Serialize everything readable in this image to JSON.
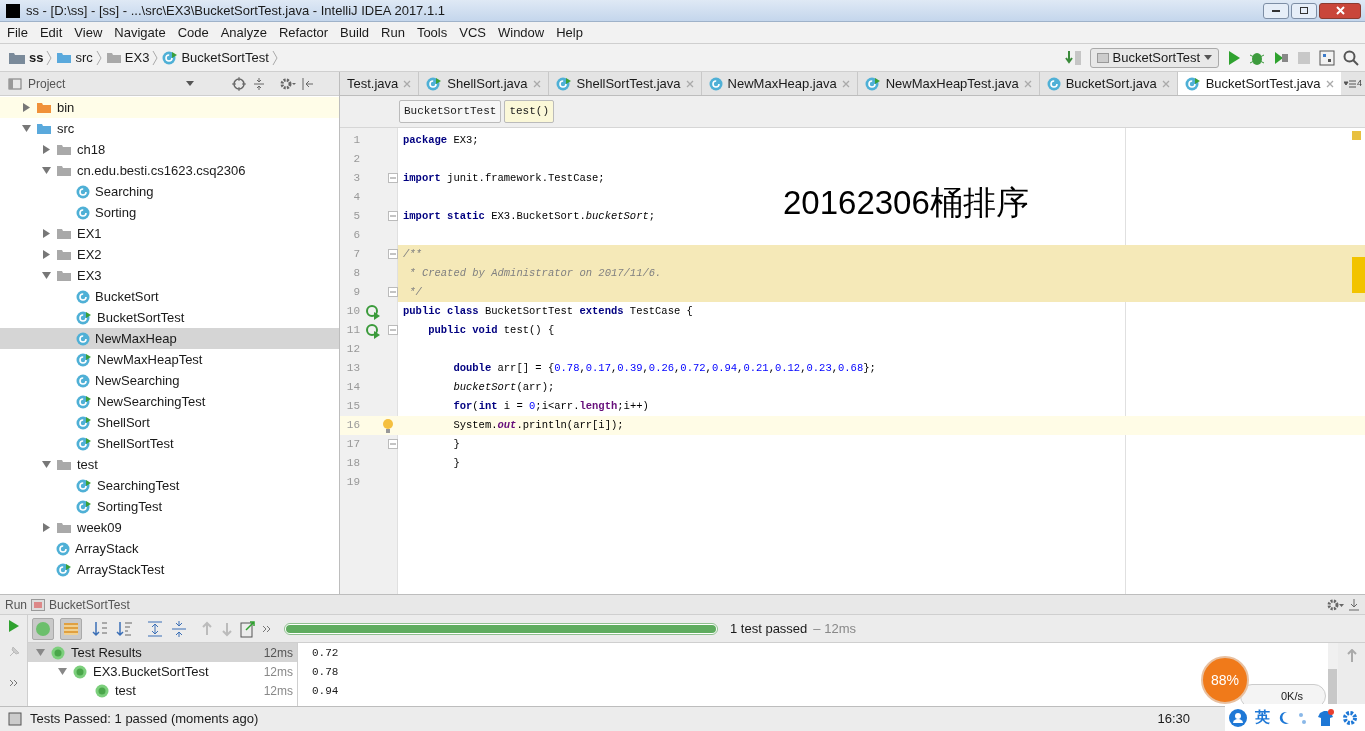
{
  "window": {
    "title": "ss - [D:\\ss] - [ss] - ...\\src\\EX3\\BucketSortTest.java - IntelliJ IDEA 2017.1.1"
  },
  "menu": [
    "File",
    "Edit",
    "View",
    "Navigate",
    "Code",
    "Analyze",
    "Refactor",
    "Build",
    "Run",
    "Tools",
    "VCS",
    "Window",
    "Help"
  ],
  "breadcrumbs": [
    {
      "label": "ss",
      "kind": "project"
    },
    {
      "label": "src",
      "kind": "source"
    },
    {
      "label": "EX3",
      "kind": "package"
    },
    {
      "label": "BucketSortTest",
      "kind": "test"
    }
  ],
  "run_config": "BucketSortTest",
  "project_panel": {
    "title": "Project",
    "tree": [
      {
        "label": "bin",
        "kind": "excluded",
        "expanded": false,
        "selected": false
      },
      {
        "label": "src",
        "kind": "source",
        "expanded": true,
        "selected": false,
        "children": [
          {
            "label": "ch18",
            "kind": "package",
            "expanded": false,
            "selected": false
          },
          {
            "label": "cn.edu.besti.cs1623.csq2306",
            "kind": "package",
            "expanded": true,
            "selected": false,
            "children": [
              {
                "label": "Searching",
                "kind": "class",
                "selected": false
              },
              {
                "label": "Sorting",
                "kind": "class",
                "selected": false
              }
            ]
          },
          {
            "label": "EX1",
            "kind": "package",
            "expanded": false,
            "selected": false
          },
          {
            "label": "EX2",
            "kind": "package",
            "expanded": false,
            "selected": false
          },
          {
            "label": "EX3",
            "kind": "package",
            "expanded": true,
            "selected": false,
            "children": [
              {
                "label": "BucketSort",
                "kind": "class",
                "selected": false
              },
              {
                "label": "BucketSortTest",
                "kind": "test",
                "selected": false
              },
              {
                "label": "NewMaxHeap",
                "kind": "class",
                "selected": true
              },
              {
                "label": "NewMaxHeapTest",
                "kind": "test",
                "selected": false
              },
              {
                "label": "NewSearching",
                "kind": "class",
                "selected": false
              },
              {
                "label": "NewSearchingTest",
                "kind": "test",
                "selected": false
              },
              {
                "label": "ShellSort",
                "kind": "test",
                "selected": false
              },
              {
                "label": "ShellSortTest",
                "kind": "test",
                "selected": false
              }
            ]
          },
          {
            "label": "test",
            "kind": "package",
            "expanded": true,
            "selected": false,
            "children": [
              {
                "label": "SearchingTest",
                "kind": "test",
                "selected": false
              },
              {
                "label": "SortingTest",
                "kind": "test",
                "selected": false
              }
            ]
          },
          {
            "label": "week09",
            "kind": "package",
            "expanded": false,
            "selected": false
          },
          {
            "label": "ArrayStack",
            "kind": "class",
            "selected": false
          },
          {
            "label": "ArrayStackTest",
            "kind": "test",
            "selected": false
          }
        ]
      }
    ]
  },
  "tabs": [
    {
      "label": "Test.java",
      "kind": "none",
      "selected": false
    },
    {
      "label": "ShellSort.java",
      "kind": "test",
      "selected": false
    },
    {
      "label": "ShellSortTest.java",
      "kind": "test",
      "selected": false
    },
    {
      "label": "NewMaxHeap.java",
      "kind": "class",
      "selected": false
    },
    {
      "label": "NewMaxHeapTest.java",
      "kind": "test",
      "selected": false
    },
    {
      "label": "BucketSort.java",
      "kind": "class",
      "selected": false
    },
    {
      "label": "BucketSortTest.java",
      "kind": "test",
      "selected": true
    }
  ],
  "tabs_overflow": "4",
  "editor_breadcrumbs": [
    {
      "label": "BucketSortTest",
      "selected": false
    },
    {
      "label": "test()",
      "selected": true
    }
  ],
  "overlay_text": "20162306桶排序",
  "code": [
    {
      "number": "1",
      "fold": false,
      "run_marker": false,
      "bulb": false,
      "doc_comment": false,
      "current_line": false,
      "tokens": [
        {
          "kind": "kw",
          "text": "package"
        },
        {
          "kind": "plain",
          "text": " EX3;"
        }
      ]
    },
    {
      "number": "2",
      "fold": false,
      "run_marker": false,
      "bulb": false,
      "doc_comment": false,
      "current_line": false
    },
    {
      "number": "3",
      "fold": true,
      "run_marker": false,
      "bulb": false,
      "doc_comment": false,
      "current_line": false,
      "tokens": [
        {
          "kind": "kw",
          "text": "import"
        },
        {
          "kind": "plain",
          "text": " junit.framework.TestCase;"
        }
      ]
    },
    {
      "number": "4",
      "fold": false,
      "run_marker": false,
      "bulb": false,
      "doc_comment": false,
      "current_line": false
    },
    {
      "number": "5",
      "fold": true,
      "run_marker": false,
      "bulb": false,
      "doc_comment": false,
      "current_line": false,
      "tokens": [
        {
          "kind": "kw",
          "text": "import static"
        },
        {
          "kind": "plain",
          "text": " EX3.BucketSort."
        },
        {
          "kind": "italic",
          "text": "bucketSort"
        },
        {
          "kind": "plain",
          "text": ";"
        }
      ]
    },
    {
      "number": "6",
      "fold": false,
      "run_marker": false,
      "bulb": false,
      "doc_comment": false,
      "current_line": false
    },
    {
      "number": "7",
      "fold": true,
      "run_marker": false,
      "bulb": false,
      "doc_comment": true,
      "current_line": false,
      "tokens": [
        {
          "kind": "comment",
          "text": "/**"
        }
      ]
    },
    {
      "number": "8",
      "fold": false,
      "run_marker": false,
      "bulb": false,
      "doc_comment": true,
      "current_line": false,
      "tokens": [
        {
          "kind": "comment",
          "text": " * Created by Administrator on 2017/11/6."
        }
      ]
    },
    {
      "number": "9",
      "fold": true,
      "run_marker": false,
      "bulb": false,
      "doc_comment": true,
      "current_line": false,
      "tokens": [
        {
          "kind": "comment",
          "text": " */"
        }
      ]
    },
    {
      "number": "10",
      "fold": false,
      "run_marker": true,
      "bulb": false,
      "doc_comment": false,
      "current_line": false,
      "tokens": [
        {
          "kind": "kw",
          "text": "public class"
        },
        {
          "kind": "plain",
          "text": " BucketSortTest "
        },
        {
          "kind": "kw",
          "text": "extends"
        },
        {
          "kind": "plain",
          "text": " TestCase {"
        }
      ]
    },
    {
      "number": "11",
      "fold": true,
      "run_marker": true,
      "bulb": false,
      "doc_comment": false,
      "current_line": false,
      "tokens": [
        {
          "kind": "kw",
          "text": "    public void"
        },
        {
          "kind": "plain",
          "text": " test() {"
        }
      ]
    },
    {
      "number": "12",
      "fold": false,
      "run_marker": false,
      "bulb": false,
      "doc_comment": false,
      "current_line": false
    },
    {
      "number": "13",
      "fold": false,
      "run_marker": false,
      "bulb": false,
      "doc_comment": false,
      "current_line": false,
      "tokens": [
        {
          "kind": "kw",
          "text": "        double"
        },
        {
          "kind": "plain",
          "text": " arr[] = {"
        },
        {
          "kind": "num",
          "text": "0.78"
        },
        {
          "kind": "plain",
          "text": ","
        },
        {
          "kind": "num",
          "text": "0.17"
        },
        {
          "kind": "plain",
          "text": ","
        },
        {
          "kind": "num",
          "text": "0.39"
        },
        {
          "kind": "plain",
          "text": ","
        },
        {
          "kind": "num",
          "text": "0.26"
        },
        {
          "kind": "plain",
          "text": ","
        },
        {
          "kind": "num",
          "text": "0.72"
        },
        {
          "kind": "plain",
          "text": ","
        },
        {
          "kind": "num",
          "text": "0.94"
        },
        {
          "kind": "plain",
          "text": ","
        },
        {
          "kind": "num",
          "text": "0.21"
        },
        {
          "kind": "plain",
          "text": ","
        },
        {
          "kind": "num",
          "text": "0.12"
        },
        {
          "kind": "plain",
          "text": ","
        },
        {
          "kind": "num",
          "text": "0.23"
        },
        {
          "kind": "plain",
          "text": ","
        },
        {
          "kind": "num",
          "text": "0.68"
        },
        {
          "kind": "plain",
          "text": "};"
        }
      ]
    },
    {
      "number": "14",
      "fold": false,
      "run_marker": false,
      "bulb": false,
      "doc_comment": false,
      "current_line": false,
      "tokens": [
        {
          "kind": "italic",
          "text": "        bucketSort"
        },
        {
          "kind": "plain",
          "text": "(arr);"
        }
      ]
    },
    {
      "number": "15",
      "fold": false,
      "run_marker": false,
      "bulb": false,
      "doc_comment": false,
      "current_line": false,
      "tokens": [
        {
          "kind": "kw",
          "text": "        for"
        },
        {
          "kind": "plain",
          "text": "("
        },
        {
          "kind": "kw",
          "text": "int"
        },
        {
          "kind": "plain",
          "text": " i = "
        },
        {
          "kind": "num",
          "text": "0"
        },
        {
          "kind": "plain",
          "text": ";i<arr."
        },
        {
          "kind": "field",
          "text": "length"
        },
        {
          "kind": "plain",
          "text": ";i++)"
        }
      ]
    },
    {
      "number": "16",
      "fold": false,
      "run_marker": false,
      "bulb": true,
      "doc_comment": false,
      "current_line": true,
      "tokens": [
        {
          "kind": "plain",
          "text": "        System."
        },
        {
          "kind": "static_field",
          "text": "out"
        },
        {
          "kind": "plain",
          "text": ".println(arr[i]);"
        }
      ]
    },
    {
      "number": "17",
      "fold": true,
      "run_marker": false,
      "bulb": false,
      "doc_comment": false,
      "current_line": false,
      "tokens": [
        {
          "kind": "plain",
          "text": "        }"
        }
      ]
    },
    {
      "number": "18",
      "fold": false,
      "run_marker": false,
      "bulb": false,
      "doc_comment": false,
      "current_line": false,
      "tokens": [
        {
          "kind": "plain",
          "text": "        }"
        }
      ]
    },
    {
      "number": "19",
      "fold": false,
      "run_marker": false,
      "bulb": false,
      "doc_comment": false,
      "current_line": false
    }
  ],
  "run_panel": {
    "label": "Run",
    "config": "BucketSortTest",
    "progress": {
      "level": 1.0
    },
    "summary": "1 test passed",
    "duration": "– 12ms",
    "results": [
      {
        "label": "Test Results",
        "time": "12ms",
        "expanded": true,
        "selected": true,
        "children": [
          {
            "label": "EX3.BucketSortTest",
            "time": "12ms",
            "expanded": true,
            "selected": false,
            "children": [
              {
                "label": "test",
                "time": "12ms",
                "selected": false
              }
            ]
          }
        ]
      }
    ],
    "output": [
      "0.72",
      "0.78",
      "0.94"
    ]
  },
  "status_bar": {
    "message": "Tests Passed: 1 passed (moments ago)",
    "position": "16:30"
  },
  "tray_widget": {
    "percent": "88%",
    "speed": "0K/s",
    "ime": "英"
  }
}
